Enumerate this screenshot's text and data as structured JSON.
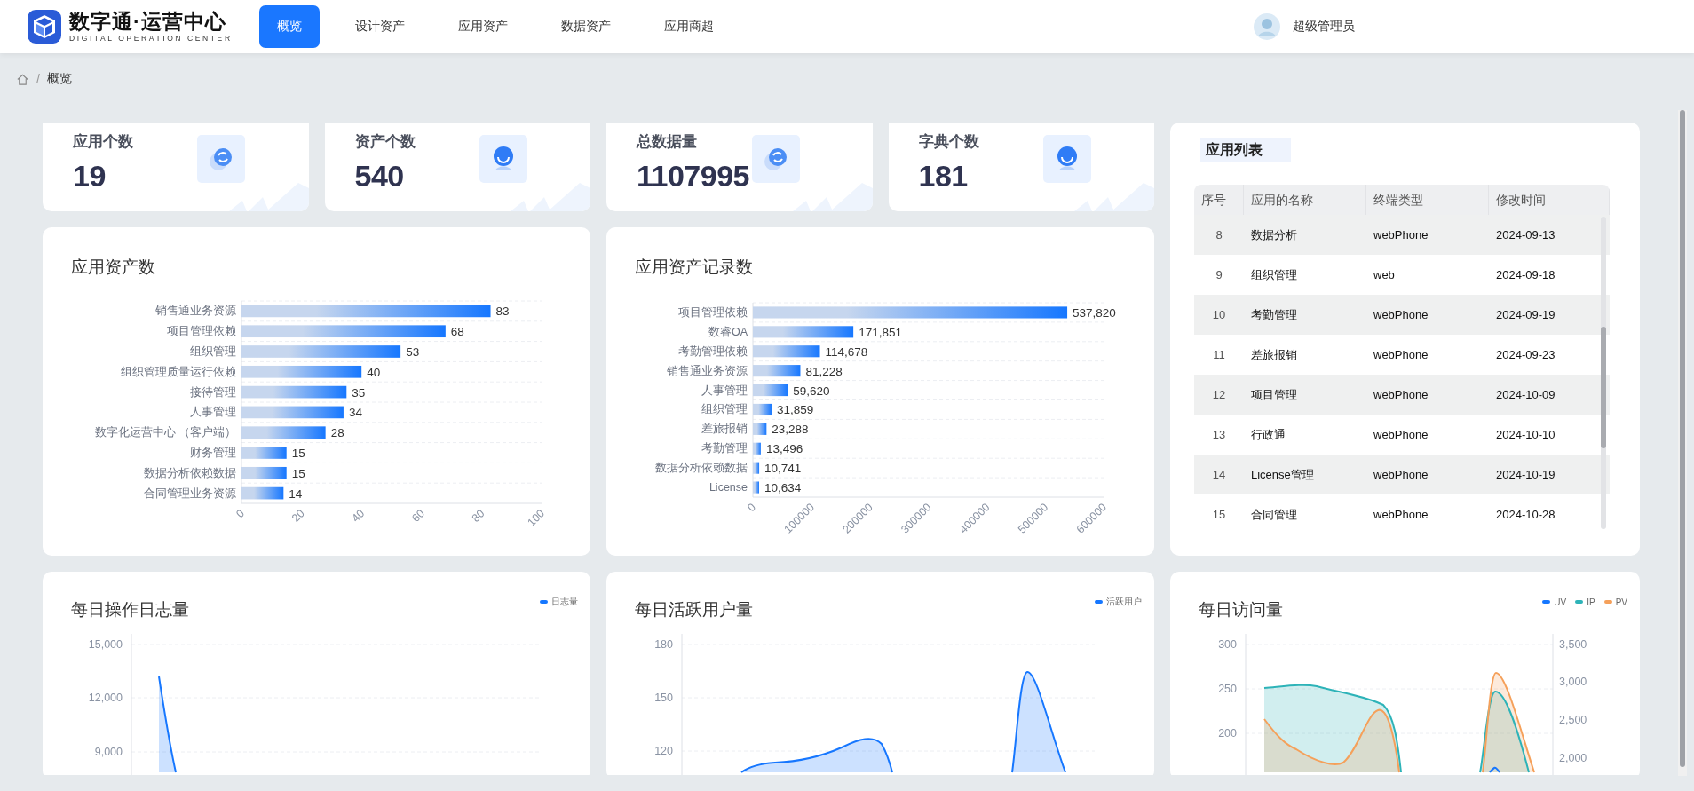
{
  "header": {
    "title": "数字通·运营中心",
    "subtitle": "DIGITAL OPERATION CENTER",
    "nav": [
      {
        "label": "概览",
        "selected": true
      },
      {
        "label": "设计资产",
        "selected": false
      },
      {
        "label": "应用资产",
        "selected": false
      },
      {
        "label": "数据资产",
        "selected": false
      },
      {
        "label": "应用商超",
        "selected": false
      }
    ],
    "user": "超级管理员"
  },
  "breadcrumb": {
    "separator": "/",
    "items": [
      "概览"
    ]
  },
  "stats": [
    {
      "label": "应用个数",
      "value": "19"
    },
    {
      "label": "资产个数",
      "value": "540"
    },
    {
      "label": "总数据量",
      "value": "1107995"
    },
    {
      "label": "字典个数",
      "value": "181"
    }
  ],
  "bar_charts": [
    {
      "title": "应用资产数",
      "chart_data": {
        "type": "bar",
        "orientation": "horizontal",
        "categories": [
          "销售通业务资源",
          "项目管理依赖",
          "组织管理",
          "组织管理质量运行依赖",
          "接待管理",
          "人事管理",
          "数字化运营中心 （客户端）",
          "财务管理",
          "数据分析依赖数据",
          "合同管理业务资源"
        ],
        "series": [
          {
            "color": "#1677ff",
            "values": [
              83,
              68,
              53,
              40,
              35,
              34,
              28,
              15,
              15,
              14
            ]
          }
        ],
        "xlim": [
          0,
          100
        ],
        "xticks": [
          0,
          20,
          40,
          60,
          80,
          100
        ],
        "value_labels": [
          "83",
          "68",
          "53",
          "40",
          "35",
          "34",
          "28",
          "15",
          "15",
          "14"
        ]
      }
    },
    {
      "title": "应用资产记录数",
      "chart_data": {
        "type": "bar",
        "orientation": "horizontal",
        "categories": [
          "项目管理依赖",
          "数睿OA",
          "考勤管理依赖",
          "销售通业务资源",
          "人事管理",
          "组织管理",
          "差旅报销",
          "考勤管理",
          "数据分析依赖数据",
          "License"
        ],
        "series": [
          {
            "color": "#1677ff",
            "values": [
              537820,
              171851,
              114678,
              81228,
              59620,
              31859,
              23288,
              13496,
              10741,
              10634
            ]
          }
        ],
        "xlim": [
          0,
          600000
        ],
        "xticks": [
          0,
          100000,
          200000,
          300000,
          400000,
          500000,
          600000
        ],
        "value_labels": [
          "537,820",
          "171,851",
          "114,678",
          "81,228",
          "59,620",
          "31,859",
          "23,288",
          "13,496",
          "10,741",
          "10,634"
        ]
      }
    }
  ],
  "app_list": {
    "title": "应用列表",
    "columns": [
      "序号",
      "应用的名称",
      "终端类型",
      "修改时间"
    ],
    "rows": [
      [
        "8",
        "数据分析",
        "webPhone",
        "2024-09-13"
      ],
      [
        "9",
        "组织管理",
        "web",
        "2024-09-18"
      ],
      [
        "10",
        "考勤管理",
        "webPhone",
        "2024-09-19"
      ],
      [
        "11",
        "差旅报销",
        "webPhone",
        "2024-09-23"
      ],
      [
        "12",
        "项目管理",
        "webPhone",
        "2024-10-09"
      ],
      [
        "13",
        "行政通",
        "webPhone",
        "2024-10-10"
      ],
      [
        "14",
        "License管理",
        "webPhone",
        "2024-10-19"
      ],
      [
        "15",
        "合同管理",
        "webPhone",
        "2024-10-28"
      ]
    ]
  },
  "line_charts": [
    {
      "title": "每日操作日志量",
      "legend": [
        {
          "label": "日志量",
          "color": "#1677ff"
        }
      ],
      "left_ticks": [
        "15,000",
        "12,000",
        "9,000"
      ]
    },
    {
      "title": "每日活跃用户量",
      "legend": [
        {
          "label": "活跃用户",
          "color": "#1677ff"
        }
      ],
      "left_ticks": [
        "180",
        "150",
        "120"
      ]
    },
    {
      "title": "每日访问量",
      "legend": [
        {
          "label": "UV",
          "color": "#1677ff"
        },
        {
          "label": "IP",
          "color": "#2db3b8"
        },
        {
          "label": "PV",
          "color": "#f5a05a"
        }
      ],
      "left_ticks": [
        "300",
        "250",
        "200"
      ],
      "right_ticks": [
        "3,500",
        "3,000",
        "2,500",
        "2,000"
      ]
    }
  ]
}
